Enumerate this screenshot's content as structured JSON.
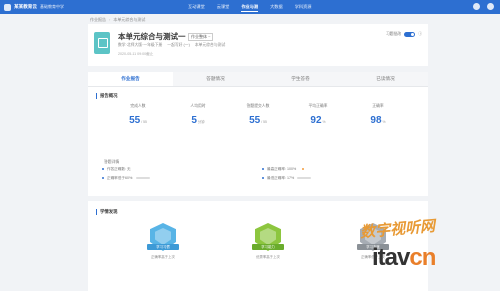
{
  "topbar": {
    "brand": "某某教育云",
    "sub": "基础教育中学",
    "nav": [
      "互动课堂",
      "云课堂",
      "作业与测",
      "大数据",
      "学科资源"
    ],
    "active_index": 2
  },
  "breadcrumb": [
    "作业报告",
    "本单元综合与测试"
  ],
  "header": {
    "title": "本单元综合与测试一",
    "type_label": "作业整体 ~",
    "meta": [
      "数学·北师大版·一年级下册",
      "一起写好 (一)",
      "本单元综合与测试"
    ],
    "date": "2020-05-11 09:00截止",
    "toggle_label": "习题批改",
    "toggle_on": true
  },
  "tabs": [
    "作业报告",
    "答题情况",
    "学生答卷",
    "已读情况"
  ],
  "active_tab": 0,
  "report": {
    "section_title": "报告概况",
    "stats": [
      {
        "label": "完成人数",
        "value": "55",
        "unit": "/ 55"
      },
      {
        "label": "人均用时",
        "value": "5",
        "unit": "分钟"
      },
      {
        "label": "答题提交人数",
        "value": "55",
        "unit": "/ 55"
      },
      {
        "label": "平均正确率",
        "value": "92",
        "unit": "%"
      },
      {
        "label": "正确率",
        "value": "98",
        "unit": "%"
      }
    ],
    "detail_title": "答题详情",
    "detail_items": [
      {
        "text": "作答正确数: 无"
      },
      {
        "text": "最高正确率: 100%"
      },
      {
        "text": "正确率低于60%:"
      },
      {
        "text": "最低正确率: 17%"
      }
    ]
  },
  "learning": {
    "section_title": "学情发现",
    "badges": [
      {
        "ribbon": "学习习惯",
        "desc": "正确率高于上次",
        "color": "#58b4e6",
        "ribbon_color": "#3d9ad6"
      },
      {
        "ribbon": "学习能力",
        "desc": "优秀率高于上次",
        "color": "#8dc63f",
        "ribbon_color": "#6aac2c"
      },
      {
        "ribbon": "学习态度",
        "desc": "正确率低于上次",
        "color": "#a7adb4",
        "ribbon_color": "#8b9197"
      }
    ]
  },
  "watermark": {
    "top": "数字视听网",
    "bottom_black": "itav",
    "bottom_orange": "cn"
  }
}
